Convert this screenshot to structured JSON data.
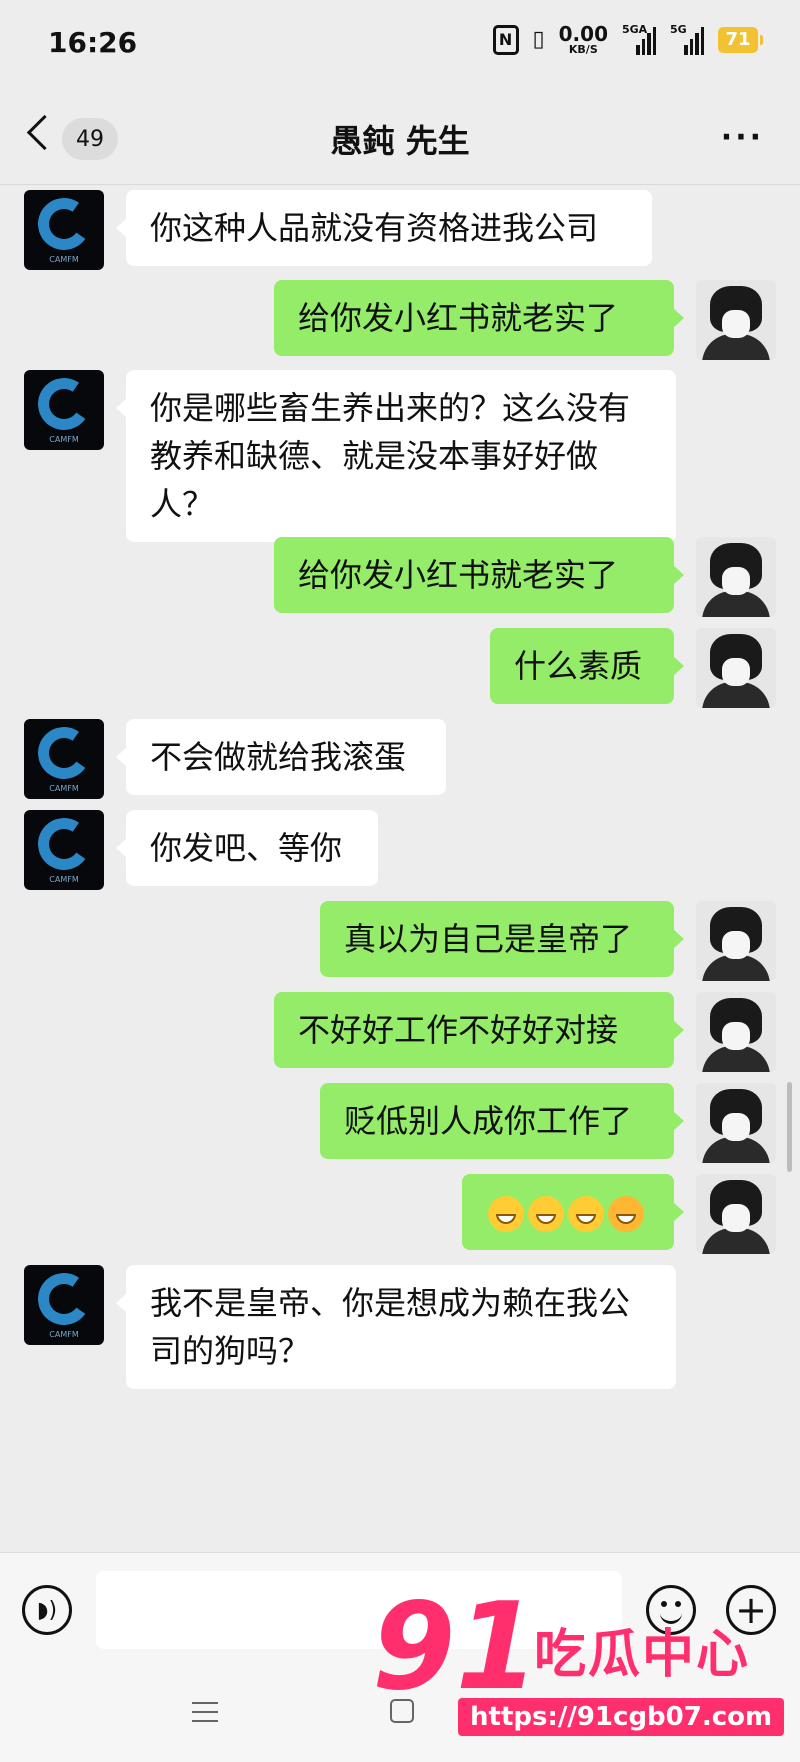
{
  "status_bar": {
    "time": "16:26",
    "network_speed_value": "0.00",
    "network_speed_unit": "KB/S",
    "signal1_label": "5GA",
    "signal2_label": "5G",
    "battery": "71"
  },
  "header": {
    "unread_count": "49",
    "title": "愚鈍 先生"
  },
  "avatars": {
    "incoming_text": "CAMFM"
  },
  "messages": [
    {
      "side": "in",
      "text": "你这种人品就没有资格进我公司"
    },
    {
      "side": "out",
      "text": "给你发小红书就老实了"
    },
    {
      "side": "in",
      "text": "你是哪些畜生养出来的？这么没有教养和缺德、就是没本事好好做人？"
    },
    {
      "side": "out",
      "text": "给你发小红书就老实了"
    },
    {
      "side": "out",
      "text": "什么素质"
    },
    {
      "side": "in",
      "text": "不会做就给我滚蛋"
    },
    {
      "side": "in",
      "text": "你发吧、等你"
    },
    {
      "side": "out",
      "text": "真以为自己是皇帝了"
    },
    {
      "side": "out",
      "text": "不好好工作不好好对接"
    },
    {
      "side": "out",
      "text": "贬低别人成你工作了"
    },
    {
      "side": "out",
      "emojis": [
        "grin-emoji",
        "grin-emoji",
        "grin-emoji",
        "thinking-emoji"
      ]
    },
    {
      "side": "in",
      "text": "我不是皇帝、你是想成为赖在我公司的狗吗？"
    }
  ],
  "input": {
    "value": "",
    "placeholder": ""
  },
  "watermark": {
    "number": "91",
    "name": "吃瓜中心",
    "url": "https://91cgb07.com"
  }
}
